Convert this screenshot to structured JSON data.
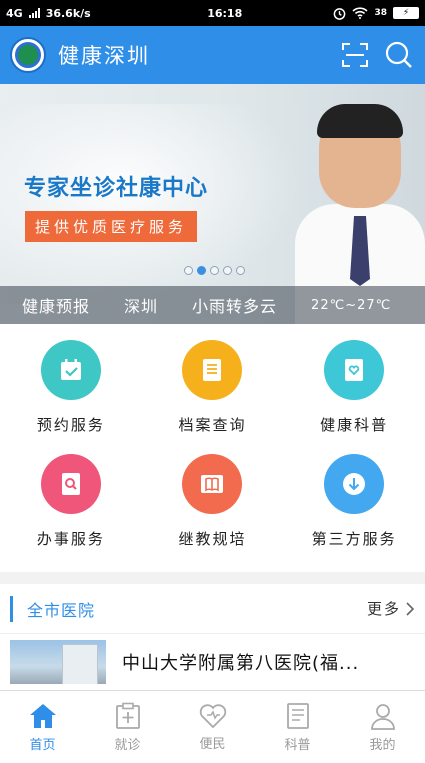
{
  "status_bar": {
    "network": "4G",
    "speed": "36.6k/s",
    "time": "16:18",
    "battery": "38"
  },
  "header": {
    "title": "健康深圳",
    "logo_icon": "health-shenzhen-logo",
    "scan_icon": "scan-icon",
    "search_icon": "search-icon"
  },
  "banner": {
    "heading": "专家坐诊社康中心",
    "subheading": "提供优质医疗服务",
    "slide_count": 5,
    "active_slide": 2,
    "weather": {
      "label": "健康预报",
      "city": "深圳",
      "condition": "小雨转多云",
      "temperature": "22℃~27℃"
    }
  },
  "services": [
    {
      "label": "预约服务",
      "icon": "calendar-check-icon",
      "color": "#3ec7c4"
    },
    {
      "label": "档案查询",
      "icon": "document-list-icon",
      "color": "#f5b01c"
    },
    {
      "label": "健康科普",
      "icon": "heart-book-icon",
      "color": "#3ec7d6"
    },
    {
      "label": "办事服务",
      "icon": "search-document-icon",
      "color": "#f0557a"
    },
    {
      "label": "继教规培",
      "icon": "open-book-icon",
      "color": "#f26b4f"
    },
    {
      "label": "第三方服务",
      "icon": "download-icon",
      "color": "#43a8ef"
    }
  ],
  "hospitals": {
    "title": "全市医院",
    "more_label": "更多",
    "items": [
      {
        "name": "中山大学附属第八医院(福..."
      }
    ]
  },
  "tabbar": [
    {
      "label": "首页",
      "icon": "home-icon",
      "active": true
    },
    {
      "label": "就诊",
      "icon": "medical-clipboard-icon",
      "active": false
    },
    {
      "label": "便民",
      "icon": "heart-outline-icon",
      "active": false
    },
    {
      "label": "科普",
      "icon": "book-icon",
      "active": false
    },
    {
      "label": "我的",
      "icon": "user-icon",
      "active": false
    }
  ],
  "colors": {
    "primary": "#2f8ee8",
    "banner_tag": "#ee6a3a"
  }
}
